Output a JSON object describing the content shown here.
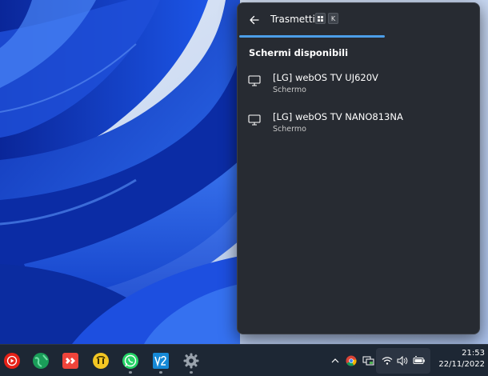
{
  "panel": {
    "title": "Trasmetti",
    "shortcut_key": "K",
    "section_title": "Schermi disponibili",
    "devices": [
      {
        "name": "[LG] webOS TV UJ620V",
        "type": "Schermo",
        "icon": "monitor-icon"
      },
      {
        "name": "[LG] webOS TV NANO813NA",
        "type": "Schermo",
        "icon": "monitor-icon"
      }
    ],
    "accent_color": "#4c9ee8",
    "background_color": "#272b32"
  },
  "taskbar": {
    "apps": [
      {
        "name": "youtube-music-icon"
      },
      {
        "name": "globe-browser-icon"
      },
      {
        "name": "anydesk-icon"
      },
      {
        "name": "tinder-like-app-icon"
      },
      {
        "name": "whatsapp-icon"
      },
      {
        "name": "vscode-like-app-icon"
      },
      {
        "name": "settings-gear-icon"
      }
    ],
    "tray": {
      "icons": [
        "chevron-up-icon",
        "chrome-icon",
        "network-monitor-icon",
        "wifi-icon",
        "volume-icon",
        "battery-icon"
      ]
    },
    "clock": {
      "time": "21:53",
      "date": "22/11/2022"
    },
    "background_color": "#1d2734"
  }
}
